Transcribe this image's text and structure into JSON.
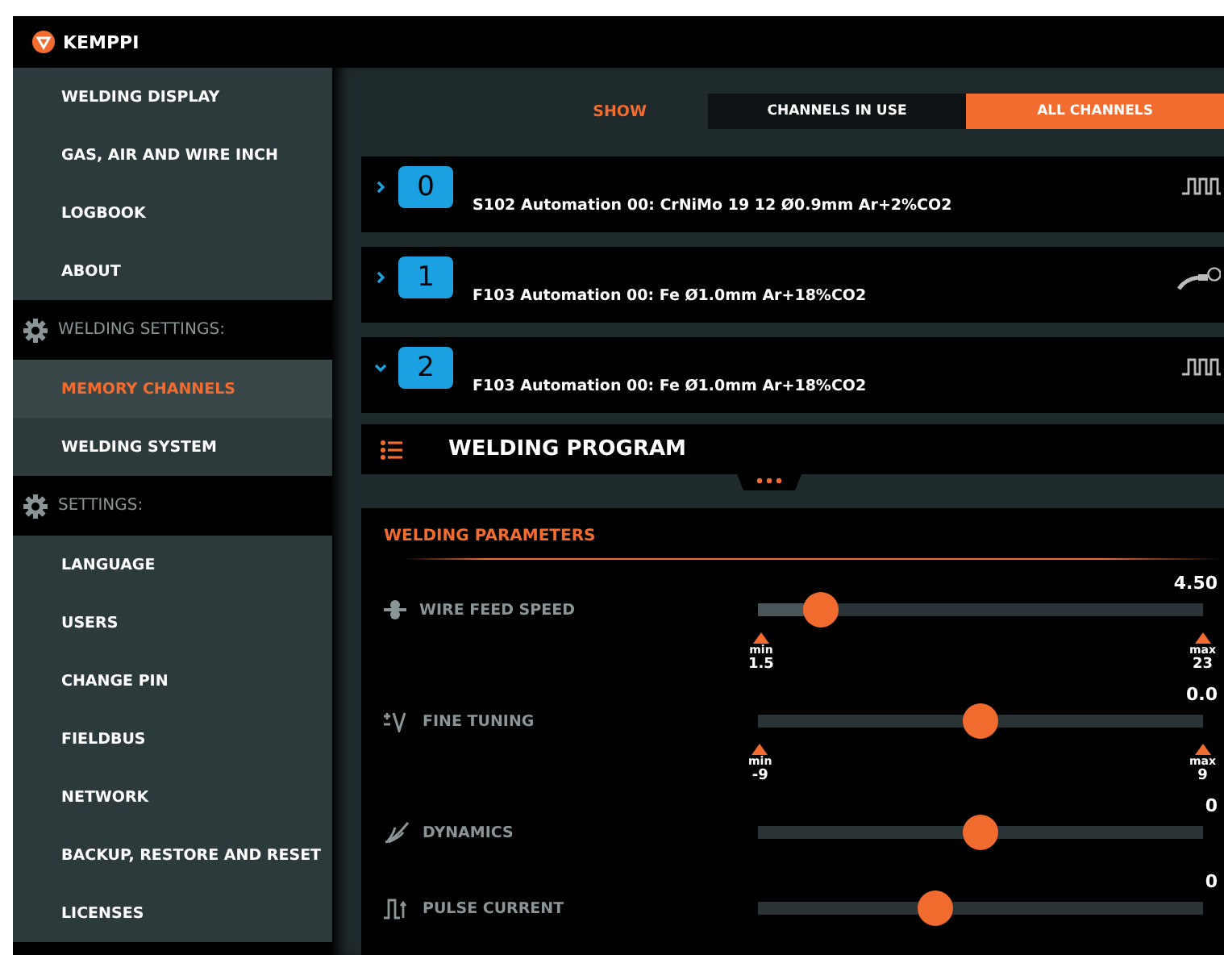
{
  "header": {
    "brand": "KEMPPI"
  },
  "sidebar": {
    "groups": [
      {
        "items": [
          {
            "label": "WELDING DISPLAY",
            "selected": false
          },
          {
            "label": "GAS, AIR AND WIRE INCH",
            "selected": false
          },
          {
            "label": "LOGBOOK",
            "selected": false
          },
          {
            "label": "ABOUT",
            "selected": false
          }
        ]
      },
      {
        "title": "WELDING SETTINGS:",
        "items": [
          {
            "label": "MEMORY CHANNELS",
            "selected": true
          },
          {
            "label": "WELDING SYSTEM",
            "selected": false
          }
        ]
      },
      {
        "title": "SETTINGS:",
        "items": [
          {
            "label": "LANGUAGE",
            "selected": false
          },
          {
            "label": "USERS",
            "selected": false
          },
          {
            "label": "CHANGE PIN",
            "selected": false
          },
          {
            "label": "FIELDBUS",
            "selected": false
          },
          {
            "label": "NETWORK",
            "selected": false
          },
          {
            "label": "BACKUP, RESTORE AND RESET",
            "selected": false
          },
          {
            "label": "LICENSES",
            "selected": false
          }
        ]
      }
    ]
  },
  "show": {
    "label": "SHOW",
    "options": [
      {
        "label": "CHANNELS IN USE",
        "selected": false
      },
      {
        "label": "ALL CHANNELS",
        "selected": true
      }
    ]
  },
  "channels": [
    {
      "number": "0",
      "name": "S102 Automation 00: CrNiMo 19 12 Ø0.9mm Ar+2%CO2",
      "expanded": false,
      "kind": "pulse"
    },
    {
      "number": "1",
      "name": "F103 Automation 00: Fe Ø1.0mm Ar+18%CO2",
      "expanded": false,
      "kind": "torch"
    },
    {
      "number": "2",
      "name": "F103 Automation 00: Fe Ø1.0mm Ar+18%CO2",
      "expanded": true,
      "kind": "pulse"
    }
  ],
  "program": {
    "title": "WELDING PROGRAM"
  },
  "parameters": {
    "title": "WELDING PARAMETERS",
    "items": [
      {
        "kind": "wire",
        "label": "WIRE FEED SPEED",
        "value": "4.50",
        "level": 0.14,
        "min": "1.5",
        "max": "23",
        "min_label": "min",
        "max_label": "max"
      },
      {
        "kind": "tuning",
        "label": "FINE TUNING",
        "value": "0.0",
        "level": 0.5,
        "min": "-9",
        "max": "9",
        "min_label": "min",
        "max_label": "max"
      },
      {
        "kind": "dynamics",
        "label": "DYNAMICS",
        "value": "0",
        "level": 0.5
      },
      {
        "kind": "pulse",
        "label": "PULSE CURRENT",
        "value": "0",
        "level": 0.4
      }
    ]
  }
}
